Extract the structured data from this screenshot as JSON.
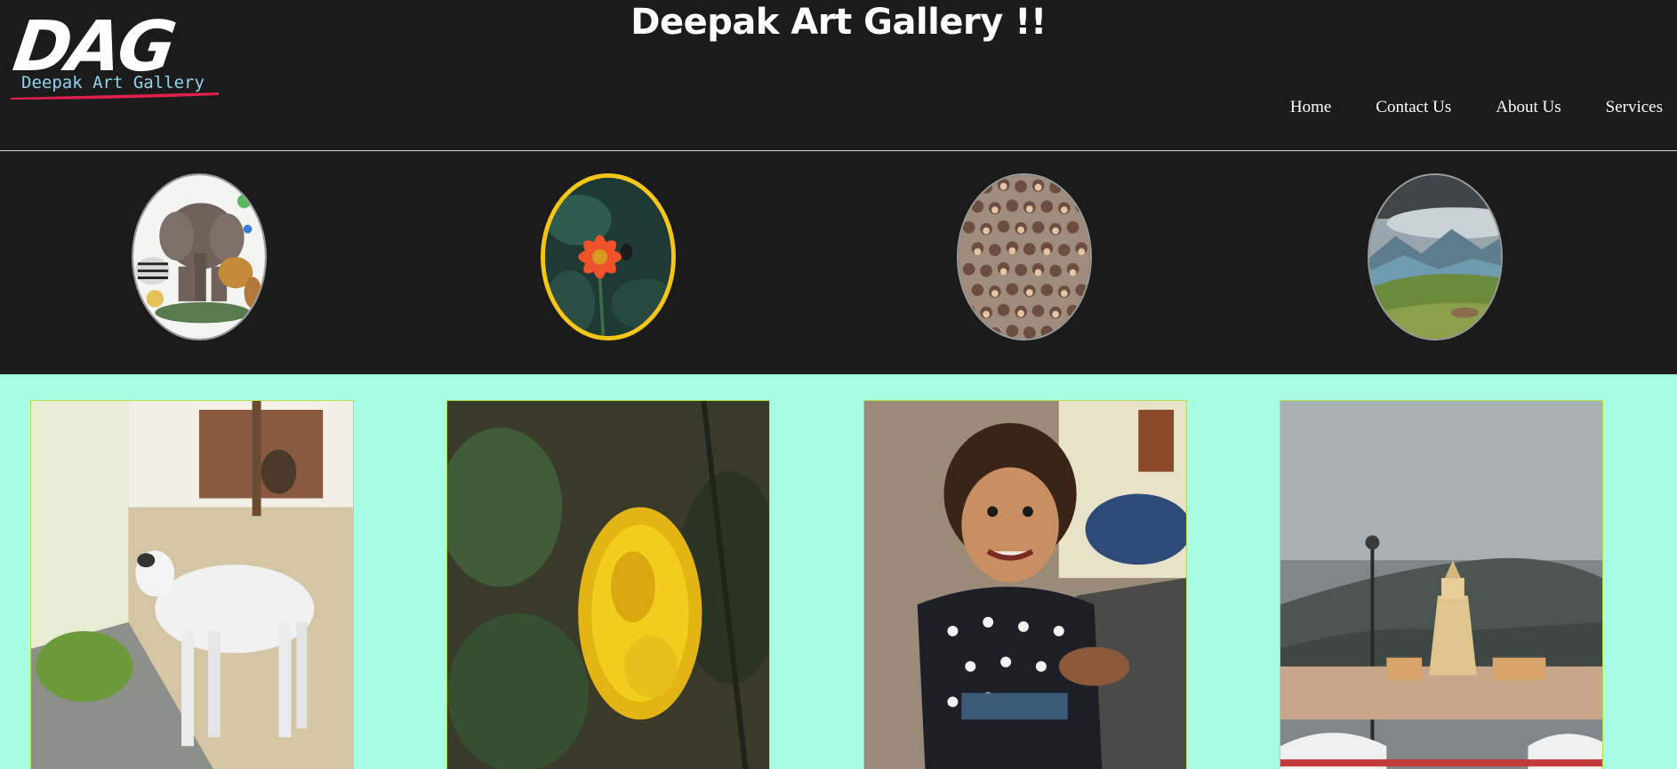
{
  "header": {
    "logo_letters": "DAG",
    "logo_subtitle": "Deepak Art Gallery",
    "title": "Deepak Art Gallery !!"
  },
  "nav": {
    "items": [
      "Home",
      "Contact Us",
      "About Us",
      "Services"
    ]
  },
  "categories": [
    {
      "subject": "wild animals collage",
      "selected": false
    },
    {
      "subject": "orange flower",
      "selected": true
    },
    {
      "subject": "crowd of faces",
      "selected": false
    },
    {
      "subject": "mountain landscape",
      "selected": false
    }
  ],
  "gallery": [
    {
      "subject": "white calf eating grass"
    },
    {
      "subject": "yellow marigold flower"
    },
    {
      "subject": "smiling toddler in polka dot dress"
    },
    {
      "subject": "temple under cloudy sky"
    }
  ],
  "colors": {
    "header_bg": "#1b1b1b",
    "gallery_bg": "#a6fde1",
    "active_border": "#f5c518",
    "logo_accent": "#e0204a"
  }
}
